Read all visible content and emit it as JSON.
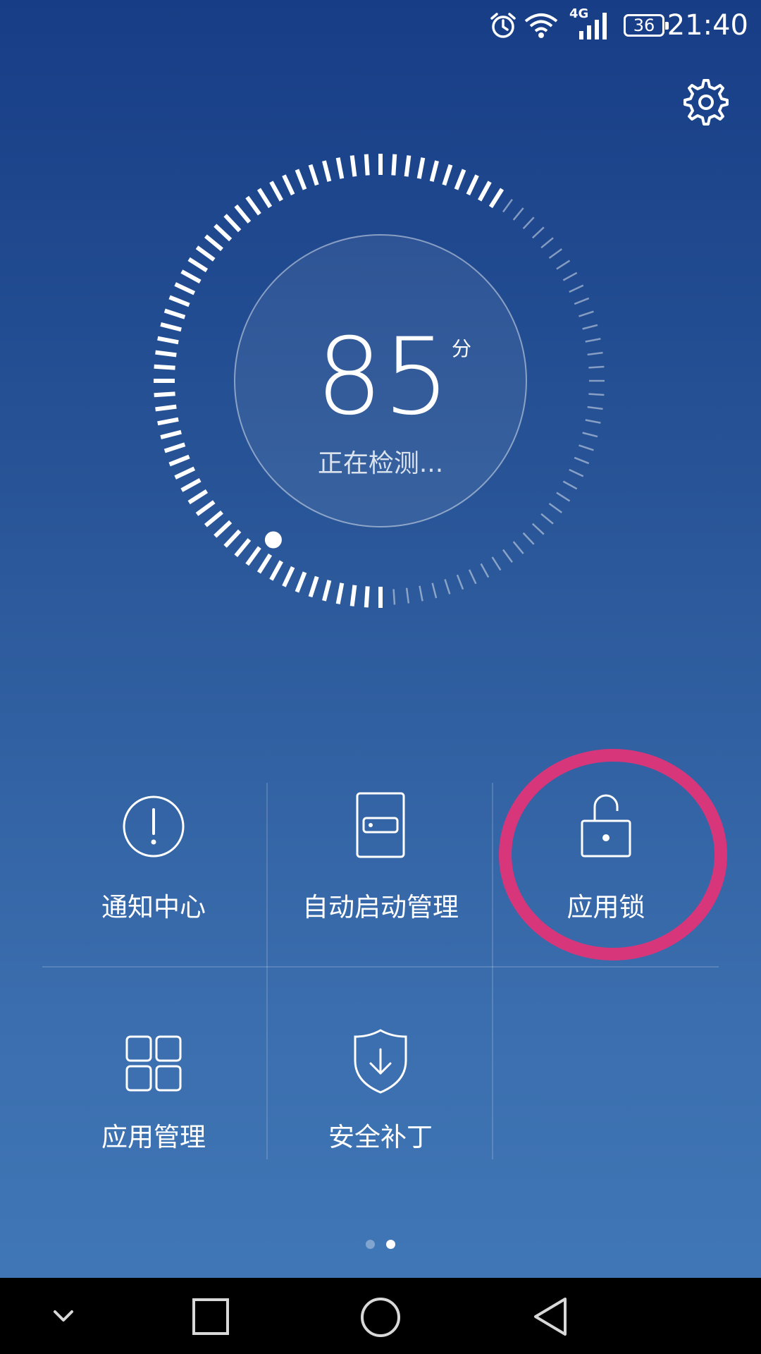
{
  "status_bar": {
    "time": "21:40",
    "battery": "36",
    "network": "4G"
  },
  "gauge": {
    "score": "85",
    "unit": "分",
    "status": "正在检测..."
  },
  "tiles": [
    {
      "label": "通知中心",
      "icon": "alert-circle-icon"
    },
    {
      "label": "自动启动管理",
      "icon": "auto-start-icon"
    },
    {
      "label": "应用锁",
      "icon": "padlock-open-icon"
    },
    {
      "label": "应用管理",
      "icon": "grid-apps-icon"
    },
    {
      "label": "安全补丁",
      "icon": "shield-download-icon"
    }
  ],
  "pager": {
    "pages": 2,
    "active": 2
  },
  "colors": {
    "background_top": "#173d86",
    "background_bottom": "#4179b8",
    "highlight": "#d8367a",
    "nav_bar": "#000000"
  }
}
